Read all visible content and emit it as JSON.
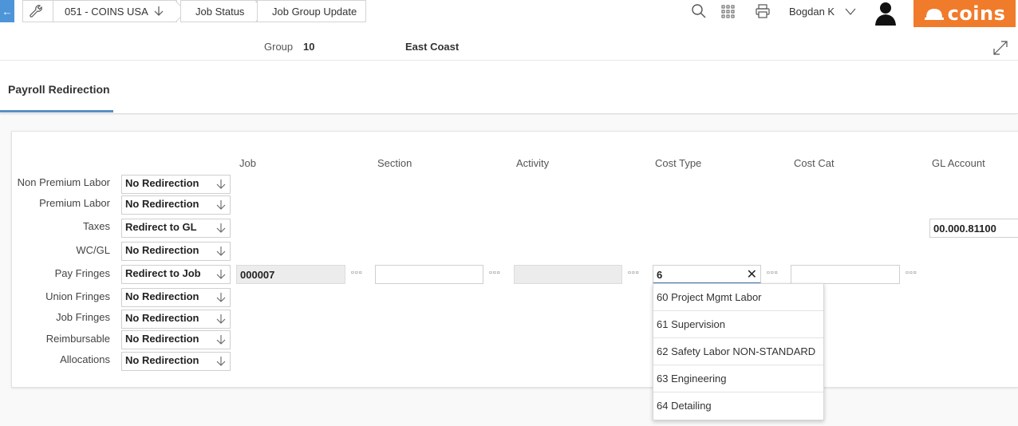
{
  "header": {
    "back_icon": "arrow-left-icon",
    "breadcrumbs": [
      {
        "label": "051 - COINS USA",
        "icon": "arrow-down-icon"
      },
      {
        "label": "Job Status"
      },
      {
        "label": "Job Group Update"
      }
    ],
    "user": "Bogdan K",
    "logo_text": "coins",
    "logo_color": "#f07b2b"
  },
  "group": {
    "label": "Group",
    "value": "10",
    "description": "East Coast"
  },
  "tabs": [
    {
      "label": "Payroll Redirection",
      "active": true
    }
  ],
  "columns": [
    "Job",
    "Section",
    "Activity",
    "Cost Type",
    "Cost Cat",
    "GL Account"
  ],
  "rows": [
    {
      "label": "Non Premium Labor",
      "redirection": "No Redirection"
    },
    {
      "label": "Premium Labor",
      "redirection": "No Redirection"
    },
    {
      "label": "Taxes",
      "redirection": "Redirect to GL",
      "gl_account": "00.000.81100"
    },
    {
      "label": "WC/GL",
      "redirection": "No Redirection"
    },
    {
      "label": "Pay Fringes",
      "redirection": "Redirect to Job",
      "job": "000007",
      "section": "",
      "activity": "",
      "cost_type": "6",
      "cost_cat": ""
    },
    {
      "label": "Union Fringes",
      "redirection": "No Redirection"
    },
    {
      "label": "Job Fringes",
      "redirection": "No Redirection"
    },
    {
      "label": "Reimbursable",
      "redirection": "No Redirection"
    },
    {
      "label": "Allocations",
      "redirection": "No Redirection"
    }
  ],
  "cost_type_dropdown": [
    "60  Project Mgmt Labor",
    "61  Supervision",
    "62  Safety Labor NON-STANDARD",
    "63  Engineering",
    "64  Detailing"
  ],
  "accent_color": "#4d95d8"
}
